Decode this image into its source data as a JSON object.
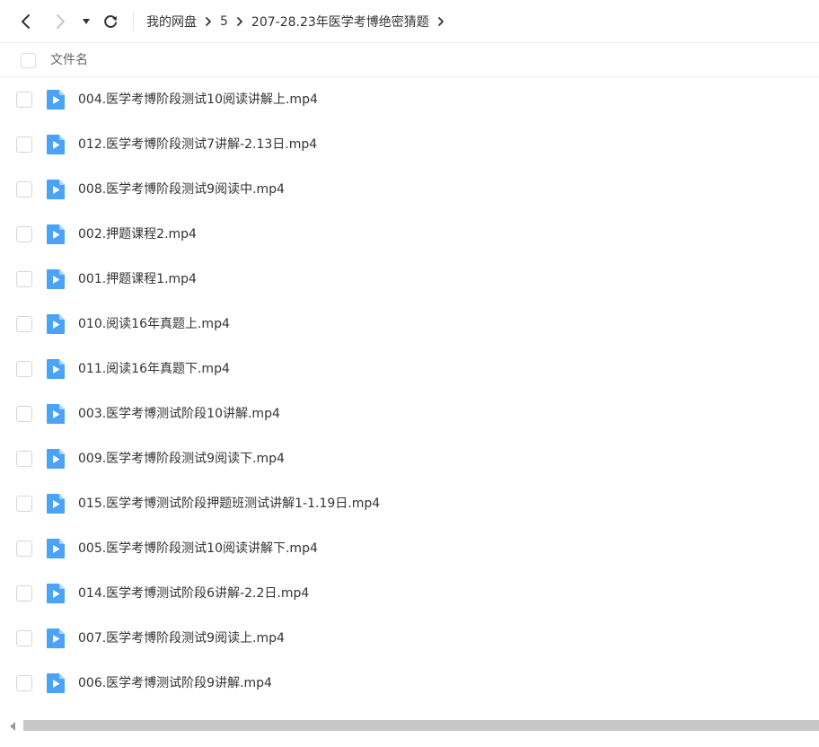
{
  "breadcrumb": {
    "items": [
      "我的网盘",
      "5",
      "207-28.23年医学考博绝密猜题"
    ]
  },
  "header": {
    "column_name": "文件名"
  },
  "files": [
    "004.医学考博阶段测试10阅读讲解上.mp4",
    "012.医学考博阶段测试7讲解-2.13日.mp4",
    "008.医学考博阶段测试9阅读中.mp4",
    "002.押题课程2.mp4",
    "001.押题课程1.mp4",
    "010.阅读16年真题上.mp4",
    "011.阅读16年真题下.mp4",
    "003.医学考博测试阶段10讲解.mp4",
    "009.医学考博阶段测试9阅读下.mp4",
    "015.医学考博测试阶段押题班测试讲解1-1.19日.mp4",
    "005.医学考博阶段测试10阅读讲解下.mp4",
    "014.医学考博测试阶段6讲解-2.2日.mp4",
    "007.医学考博阶段测试9阅读上.mp4",
    "006.医学考博测试阶段9讲解.mp4"
  ],
  "icons": {
    "back": "chevron-left-icon",
    "forward": "chevron-right-icon",
    "dropdown": "caret-down-icon",
    "refresh": "refresh-icon",
    "separator": "chevron-right-icon",
    "file": "video-file-icon"
  },
  "colors": {
    "file_icon": "#4aa3f5",
    "file_icon_fold": "#a9d4fb",
    "text": "#333333",
    "muted": "#666666",
    "disabled": "#c8c8c8",
    "scrollbar": "#c6c6c6"
  }
}
